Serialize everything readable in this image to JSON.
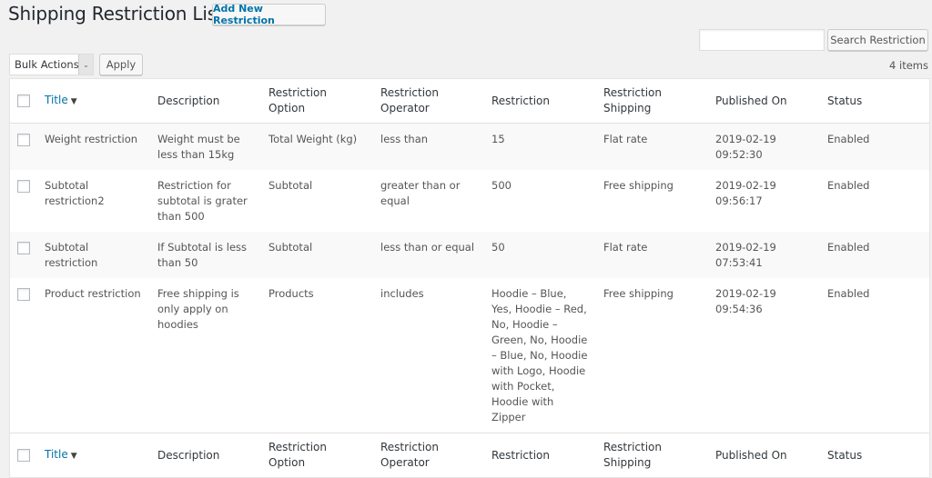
{
  "header": {
    "title": "Shipping Restriction List",
    "add_new_label": "Add New Restriction"
  },
  "search": {
    "value": "",
    "placeholder": "",
    "button_label": "Search Restriction"
  },
  "bulk_actions": {
    "selected": "Bulk Actions",
    "apply_label": "Apply"
  },
  "items_count": "4 items",
  "colors": {
    "accent": "#0073aa",
    "background": "#f1f1f1"
  },
  "table": {
    "columns": [
      {
        "key": "title",
        "label": "Title",
        "sortable": true,
        "sort_icon": "caret-down-icon"
      },
      {
        "key": "description",
        "label": "Description"
      },
      {
        "key": "option",
        "label": "Restriction Option"
      },
      {
        "key": "operator",
        "label": "Restriction Operator"
      },
      {
        "key": "restriction",
        "label": "Restriction"
      },
      {
        "key": "shipping",
        "label": "Restriction Shipping"
      },
      {
        "key": "published",
        "label": "Published On"
      },
      {
        "key": "status",
        "label": "Status"
      }
    ],
    "rows": [
      {
        "title": "Weight restriction",
        "description": "Weight must be less than 15kg",
        "option": "Total Weight (kg)",
        "operator": "less than",
        "restriction": "15",
        "shipping": "Flat rate",
        "published": "2019-02-19 09:52:30",
        "status": "Enabled"
      },
      {
        "title": "Subtotal restriction2",
        "description": "Restriction for subtotal is grater than 500",
        "option": "Subtotal",
        "operator": "greater than or equal",
        "restriction": "500",
        "shipping": "Free shipping",
        "published": "2019-02-19 09:56:17",
        "status": "Enabled"
      },
      {
        "title": "Subtotal restriction",
        "description": "If Subtotal is less than 50",
        "option": "Subtotal",
        "operator": "less than or equal",
        "restriction": "50",
        "shipping": "Flat rate",
        "published": "2019-02-19 07:53:41",
        "status": "Enabled"
      },
      {
        "title": "Product restriction",
        "description": "Free shipping is only apply on hoodies",
        "option": "Products",
        "operator": "includes",
        "restriction": "Hoodie – Blue, Yes, Hoodie – Red, No, Hoodie – Green, No, Hoodie – Blue, No, Hoodie with Logo, Hoodie with Pocket, Hoodie with Zipper",
        "shipping": "Free shipping",
        "published": "2019-02-19 09:54:36",
        "status": "Enabled"
      }
    ]
  }
}
